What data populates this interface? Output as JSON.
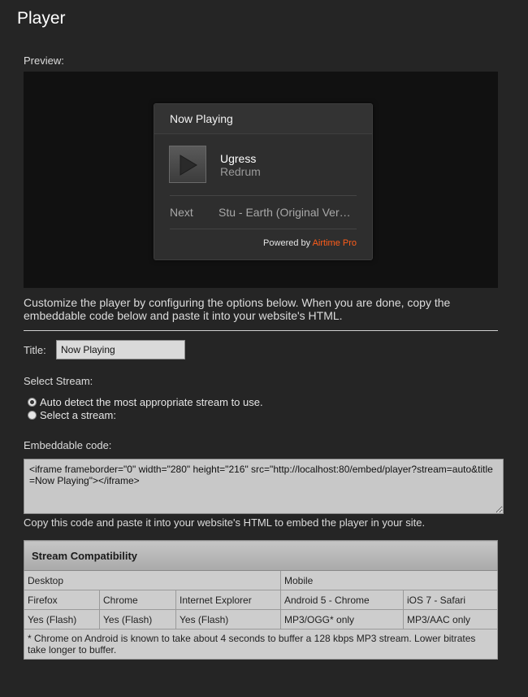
{
  "page": {
    "title": "Player"
  },
  "preview": {
    "label": "Preview:",
    "player": {
      "header": "Now Playing",
      "track_title": "Ugress",
      "track_artist": "Redrum",
      "next_label": "Next",
      "next_track": "Stu - Earth (Original Ver…",
      "powered_by": "Powered by",
      "brand": "Airtime Pro",
      "brand_color": "#ff5d1a",
      "play_icon": "play-icon"
    }
  },
  "intro_text": "Customize the player by configuring the options below. When you are done, copy the embeddable code below and paste it into your website's HTML.",
  "title_field": {
    "label": "Title:",
    "value": "Now Playing"
  },
  "stream": {
    "label": "Select Stream:",
    "options": [
      {
        "label": "Auto detect the most appropriate stream to use.",
        "checked": true
      },
      {
        "label": "Select a stream:",
        "checked": false
      }
    ]
  },
  "embed": {
    "label": "Embeddable code:",
    "code": "<iframe frameborder=\"0\" width=\"280\" height=\"216\" src=\"http://localhost:80/embed/player?stream=auto&title=Now Playing\"></iframe>",
    "help": "Copy this code and paste it into your website's HTML to embed the player in your site."
  },
  "compat": {
    "title": "Stream Compatibility",
    "groups": [
      "Desktop",
      "Mobile"
    ],
    "browsers": [
      "Firefox",
      "Chrome",
      "Internet Explorer",
      "Android 5 - Chrome",
      "iOS 7 - Safari"
    ],
    "support": [
      "Yes (Flash)",
      "Yes (Flash)",
      "Yes (Flash)",
      "MP3/OGG* only",
      "MP3/AAC only"
    ],
    "note": "* Chrome on Android is known to take about 4 seconds to buffer a 128 kbps MP3 stream. Lower bitrates take longer to buffer."
  }
}
